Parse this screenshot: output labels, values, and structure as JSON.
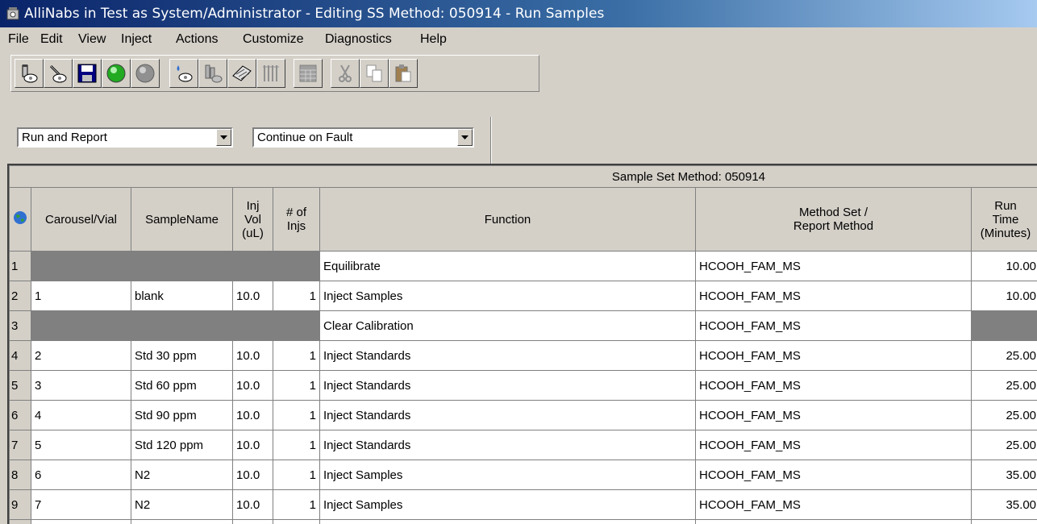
{
  "window": {
    "title": "AlliNabs in Test as System/Administrator - Editing SS Method: 050914 - Run Samples"
  },
  "menu": [
    "File",
    "Edit",
    "View",
    "Inject",
    "Actions",
    "Customize",
    "Diagnostics",
    "Help"
  ],
  "toolbar": {
    "buttons": [
      "vials-icon",
      "syringe-icon",
      "save-icon",
      "green-circle-icon",
      "gray-circle-icon",
      "droplet-vial-icon",
      "vial-rack-icon",
      "plate-icon",
      "bars-icon",
      "grid-icon",
      "cut-icon",
      "copy-icon",
      "paste-icon"
    ]
  },
  "controls": {
    "mode": "Run and Report",
    "fault": "Continue on Fault"
  },
  "grid": {
    "caption": "Sample Set Method: 050914",
    "headers": {
      "vial": "Carousel/Vial",
      "name": "SampleName",
      "injvol": [
        "Inj",
        "Vol",
        "(uL)"
      ],
      "injs": [
        "# of",
        "Injs"
      ],
      "function": "Function",
      "method": [
        "Method Set /",
        "Report Method"
      ],
      "runtime": [
        "Run",
        "Time",
        "(Minutes)"
      ]
    },
    "rows": [
      {
        "n": "1",
        "vial": "",
        "name": "",
        "vol": "",
        "injs": "",
        "function": "Equilibrate",
        "method": "HCOOH_FAM_MS",
        "time": "10.00",
        "gray": true,
        "time_gray": false
      },
      {
        "n": "2",
        "vial": "1",
        "name": "blank",
        "vol": "10.0",
        "injs": "1",
        "function": "Inject Samples",
        "method": "HCOOH_FAM_MS",
        "time": "10.00",
        "gray": false,
        "time_gray": false
      },
      {
        "n": "3",
        "vial": "",
        "name": "",
        "vol": "",
        "injs": "",
        "function": "Clear Calibration",
        "method": "HCOOH_FAM_MS",
        "time": "",
        "gray": true,
        "time_gray": true
      },
      {
        "n": "4",
        "vial": "2",
        "name": "Std 30 ppm",
        "vol": "10.0",
        "injs": "1",
        "function": "Inject Standards",
        "method": "HCOOH_FAM_MS",
        "time": "25.00",
        "gray": false,
        "time_gray": false
      },
      {
        "n": "5",
        "vial": "3",
        "name": "Std 60 ppm",
        "vol": "10.0",
        "injs": "1",
        "function": "Inject Standards",
        "method": "HCOOH_FAM_MS",
        "time": "25.00",
        "gray": false,
        "time_gray": false
      },
      {
        "n": "6",
        "vial": "4",
        "name": "Std 90 ppm",
        "vol": "10.0",
        "injs": "1",
        "function": "Inject Standards",
        "method": "HCOOH_FAM_MS",
        "time": "25.00",
        "gray": false,
        "time_gray": false
      },
      {
        "n": "7",
        "vial": "5",
        "name": "Std 120 ppm",
        "vol": "10.0",
        "injs": "1",
        "function": "Inject Standards",
        "method": "HCOOH_FAM_MS",
        "time": "25.00",
        "gray": false,
        "time_gray": false
      },
      {
        "n": "8",
        "vial": "6",
        "name": "N2",
        "vol": "10.0",
        "injs": "1",
        "function": "Inject Samples",
        "method": "HCOOH_FAM_MS",
        "time": "35.00",
        "gray": false,
        "time_gray": false
      },
      {
        "n": "9",
        "vial": "7",
        "name": "N2",
        "vol": "10.0",
        "injs": "1",
        "function": "Inject Samples",
        "method": "HCOOH_FAM_MS",
        "time": "35.00",
        "gray": false,
        "time_gray": false
      }
    ]
  }
}
